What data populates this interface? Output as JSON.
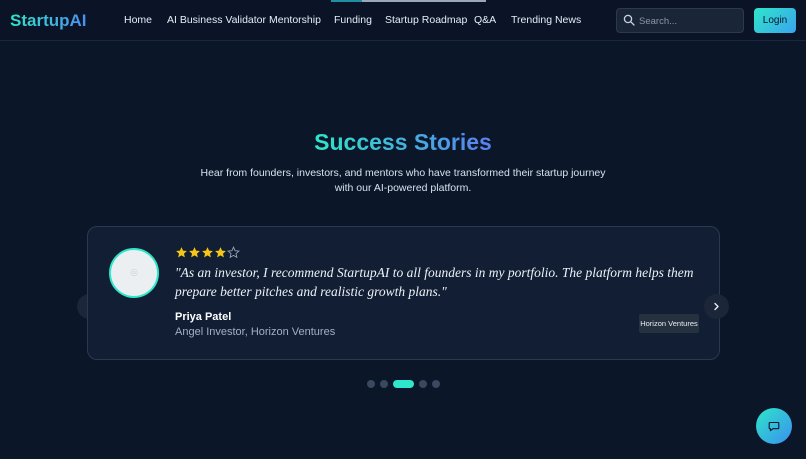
{
  "brand": {
    "name": "StartupAI"
  },
  "nav": {
    "links": [
      "Home",
      "AI Business Validator",
      "Mentorship",
      "Funding",
      "Startup Roadmap",
      "Q&A",
      "Trending News"
    ]
  },
  "search": {
    "placeholder": "Search..."
  },
  "login": {
    "label": "Login"
  },
  "hero": {
    "title": "Success Stories",
    "subtitle": "Hear from founders, investors, and mentors who have transformed their startup journey with our AI-powered platform."
  },
  "testimonial": {
    "rating": 4,
    "max_rating": 5,
    "quote": "\"As an investor, I recommend StartupAI to all founders in my portfolio. The platform helps them prepare better pitches and realistic growth plans.\"",
    "author": "Priya Patel",
    "role": "Angel Investor, Horizon Ventures",
    "company": "Horizon Ventures"
  },
  "carousel": {
    "slide_count": 5,
    "active_index": 2
  },
  "icons": {
    "search": "search-icon",
    "prev": "chevron-left-icon",
    "next": "chevron-right-icon",
    "chat": "chat-icon",
    "star": "star-icon"
  },
  "colors": {
    "background": "#0b1629",
    "accent": "#2ee6c9",
    "accent_blue": "#4f8df2",
    "star": "#f5c518"
  }
}
